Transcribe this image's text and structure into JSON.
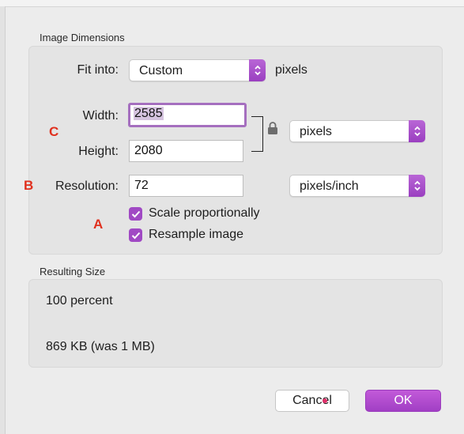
{
  "image_dimensions": {
    "title": "Image Dimensions",
    "fit_into_label": "Fit into:",
    "fit_into_value": "Custom",
    "fit_into_unit": "pixels",
    "width_label": "Width:",
    "width_value": "2585",
    "height_label": "Height:",
    "height_value": "2080",
    "size_unit": "pixels",
    "resolution_label": "Resolution:",
    "resolution_value": "72",
    "resolution_unit": "pixels/inch",
    "scale_proportionally": "Scale proportionally",
    "resample_image": "Resample image"
  },
  "annotations": {
    "a": "A",
    "b": "B",
    "c": "C"
  },
  "resulting_size": {
    "title": "Resulting Size",
    "percent": "100 percent",
    "file_size": "869 KB (was 1 MB)"
  },
  "buttons": {
    "cancel": "Cancel",
    "ok": "OK"
  },
  "icons": {
    "lock": "lock-icon",
    "checkbox_scale": "checkmark-icon",
    "checkbox_resample": "checkmark-icon",
    "stepper": "up-down-chevron-icon"
  },
  "colors": {
    "accent": "#a049c4",
    "annotation": "#e0301e",
    "focus_ring": "#a56fbf"
  }
}
